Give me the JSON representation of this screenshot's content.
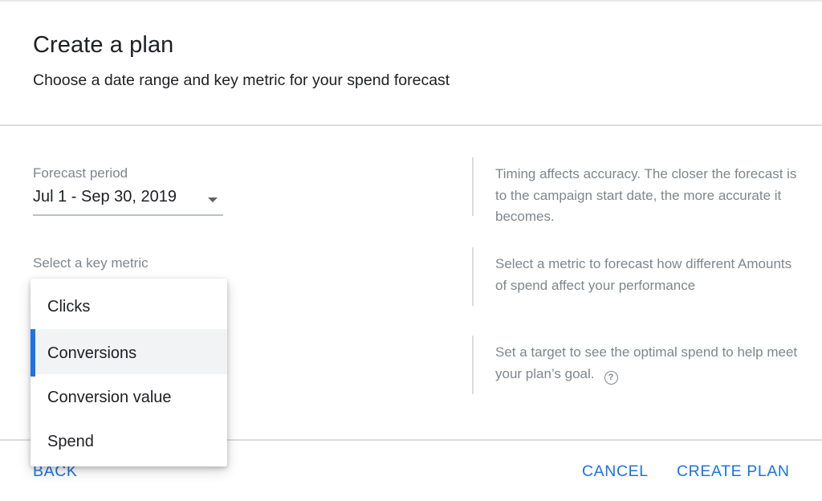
{
  "dialog": {
    "title": "Create a plan",
    "subtitle": "Choose a date range and key metric for your spend forecast"
  },
  "forecast_period": {
    "label": "Forecast period",
    "value": "Jul 1 - Sep 30, 2019"
  },
  "key_metric": {
    "label": "Select a key metric",
    "options": [
      "Clicks",
      "Conversions",
      "Conversion value",
      "Spend"
    ],
    "highlighted": "Conversions"
  },
  "help": {
    "timing": "Timing affects accuracy. The closer the forecast is to the campaign start date, the more accurate it becomes.",
    "metric": "Select a metric to forecast how different Amounts of spend affect your performance",
    "target": "Set a target to see the optimal spend to help meet your plan’s goal.",
    "target_icon": "?"
  },
  "footer": {
    "back_label": "BACK",
    "cancel_label": "CANCEL",
    "create_label": "CREATE PLAN"
  },
  "colors": {
    "accent": "#1a73e8",
    "muted_text": "#80868b",
    "highlight_bg": "#f1f3f4"
  },
  "icons": {
    "period_dropdown": "dropdown-caret-icon",
    "target_help": "help-circle-icon"
  }
}
